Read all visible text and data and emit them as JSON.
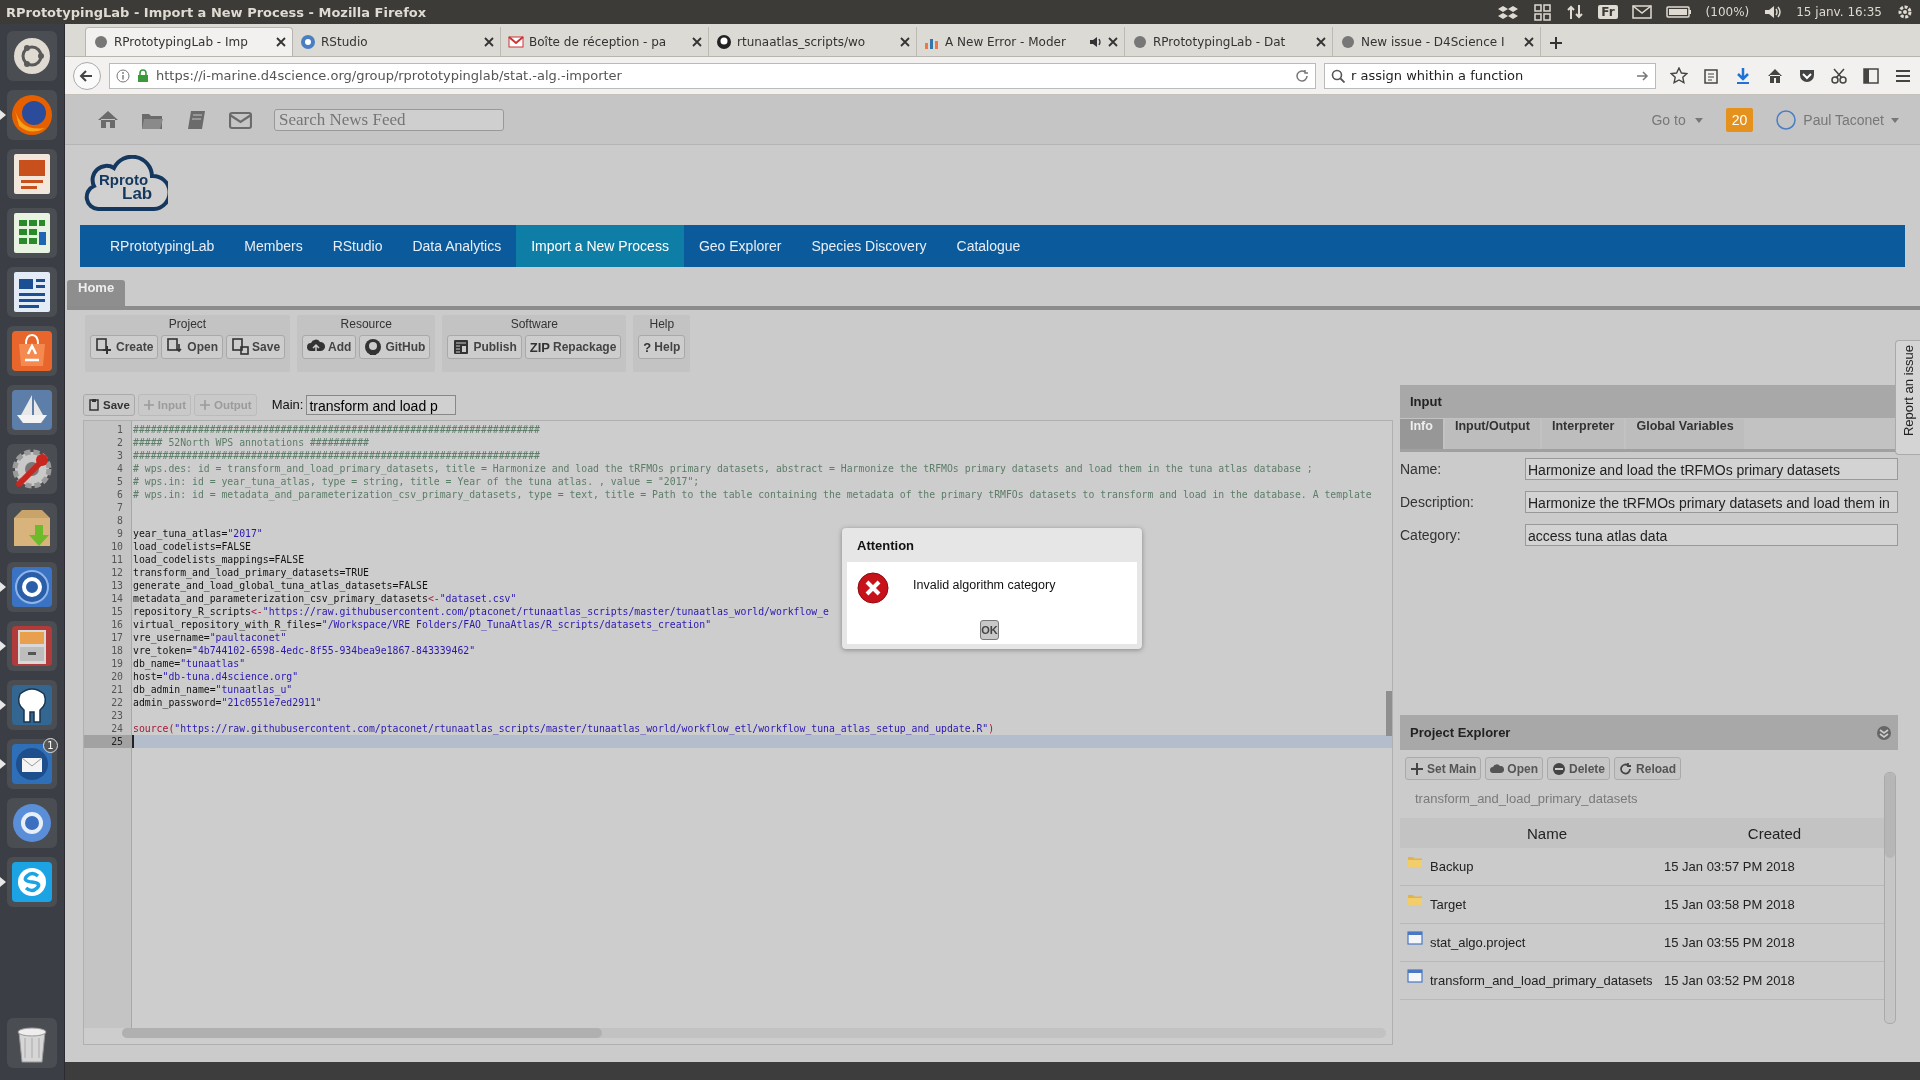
{
  "system_bar": {
    "title": "RPrototypingLab - Import a New Process - Mozilla Firefox",
    "keyboard": "Fr",
    "battery": "(100%)",
    "clock": "15 janv. 16:35"
  },
  "launcher": [
    {
      "kind": "dash",
      "running": false
    },
    {
      "kind": "firefox",
      "running": true
    },
    {
      "kind": "impress",
      "running": false
    },
    {
      "kind": "calc",
      "running": false
    },
    {
      "kind": "writer",
      "running": false
    },
    {
      "kind": "store",
      "running": false
    },
    {
      "kind": "boat",
      "running": false
    },
    {
      "kind": "tools",
      "running": false
    },
    {
      "kind": "package",
      "running": false
    },
    {
      "kind": "r",
      "running": true
    },
    {
      "kind": "cabinet",
      "running": true
    },
    {
      "kind": "elephant",
      "running": true
    },
    {
      "kind": "mail",
      "running": true,
      "badge": "1"
    },
    {
      "kind": "chromium",
      "running": false
    },
    {
      "kind": "skype",
      "running": true
    },
    {
      "kind": "trash",
      "running": false
    }
  ],
  "browser_tabs": [
    {
      "kind": "page",
      "title": "RPrototypingLab - Imp",
      "selected": true,
      "audio": false
    },
    {
      "kind": "rstudio",
      "title": "RStudio",
      "selected": false,
      "audio": false
    },
    {
      "kind": "mail",
      "title": "Boîte de réception - pa",
      "selected": false,
      "audio": false
    },
    {
      "kind": "github",
      "title": "rtunaatlas_scripts/wo",
      "selected": false,
      "audio": false
    },
    {
      "kind": "chart",
      "title": "A New Error - Moder",
      "selected": false,
      "audio": true
    },
    {
      "kind": "page",
      "title": "RPrototypingLab - Dat",
      "selected": false,
      "audio": false
    },
    {
      "kind": "page",
      "title": "New issue - D4Science I",
      "selected": false,
      "audio": false
    }
  ],
  "address_bar": {
    "url": "https://i-marine.d4science.org/group/rprototypinglab/stat.-alg.-importer"
  },
  "search_bar": {
    "value": "r assign whithin a function"
  },
  "portal_header": {
    "search": {
      "placeholder": "Search News Feed"
    },
    "goto": "Go to",
    "notifications": "20",
    "user": "Paul Taconet"
  },
  "logo": {
    "line_1": "Rproto",
    "line_2": "Lab"
  },
  "nav": [
    {
      "label": "RPrototypingLab",
      "selected": false
    },
    {
      "label": "Members",
      "selected": false
    },
    {
      "label": "RStudio",
      "selected": false
    },
    {
      "label": "Data Analytics",
      "selected": false
    },
    {
      "label": "Import a New Process",
      "selected": true
    },
    {
      "label": "Geo Explorer",
      "selected": false
    },
    {
      "label": "Species Discovery",
      "selected": false
    },
    {
      "label": "Catalogue",
      "selected": false
    }
  ],
  "page_tabs": [
    {
      "label": "Home",
      "selected": true
    }
  ],
  "ribbon": [
    {
      "title": "Project",
      "buttons": [
        {
          "kind": "create",
          "label": "Create"
        },
        {
          "kind": "open",
          "label": "Open"
        },
        {
          "kind": "save",
          "label": "Save"
        }
      ]
    },
    {
      "title": "Resource",
      "buttons": [
        {
          "kind": "add",
          "label": "Add"
        },
        {
          "kind": "github",
          "label": "GitHub"
        }
      ]
    },
    {
      "title": "Software",
      "buttons": [
        {
          "kind": "publish",
          "label": "Publish"
        },
        {
          "kind": "repackage",
          "label": "Repackage",
          "icon_text": "ZIP"
        }
      ]
    },
    {
      "title": "Help",
      "buttons": [
        {
          "kind": "help",
          "label": "Help",
          "icon_text": "?"
        }
      ]
    }
  ],
  "editor": {
    "toolbar": [
      {
        "kind": "save",
        "label": "Save",
        "disabled": false
      },
      {
        "kind": "add",
        "label": "Input",
        "disabled": true
      },
      {
        "kind": "add",
        "label": "Output",
        "disabled": true
      }
    ],
    "main_label": "Main:",
    "main_value": "transform and load p",
    "lines": [
      {
        "number": "1",
        "current": false,
        "tokens": [
          {
            "kind": "comment",
            "text": "#####################################################################"
          }
        ]
      },
      {
        "number": "2",
        "current": false,
        "tokens": [
          {
            "kind": "comment",
            "text": "##### 52North WPS annotations ##########"
          }
        ]
      },
      {
        "number": "3",
        "current": false,
        "tokens": [
          {
            "kind": "comment",
            "text": "#####################################################################"
          }
        ]
      },
      {
        "number": "4",
        "current": false,
        "tokens": [
          {
            "kind": "comment",
            "text": "# wps.des: id = transform_and_load_primary_datasets, title = Harmonize and load the tRFMOs primary datasets, abstract = Harmonize the tRFMOs primary datasets and load them in the tuna atlas database ;"
          }
        ]
      },
      {
        "number": "5",
        "current": false,
        "tokens": [
          {
            "kind": "comment",
            "text": "# wps.in: id = year_tuna_atlas, type = string, title = Year of the tuna atlas. , value = \"2017\";"
          }
        ]
      },
      {
        "number": "6",
        "current": false,
        "tokens": [
          {
            "kind": "comment",
            "text": "# wps.in: id = metadata_and_parameterization_csv_primary_datasets, type = text, title = Path to the table containing the metadata of the primary tRMFOs datasets to transform and load in the database. A template"
          }
        ]
      },
      {
        "number": "7",
        "current": false
      },
      {
        "number": "8",
        "current": false
      },
      {
        "number": "9",
        "current": false,
        "tokens": [
          {
            "kind": "plain",
            "text": "year_tuna_atlas="
          },
          {
            "kind": "string",
            "text": "\"2017\""
          }
        ]
      },
      {
        "number": "10",
        "current": false,
        "tokens": [
          {
            "kind": "plain",
            "text": "load_codelists=FALSE"
          }
        ]
      },
      {
        "number": "11",
        "current": false,
        "tokens": [
          {
            "kind": "plain",
            "text": "load_codelists_mappings=FALSE"
          }
        ]
      },
      {
        "number": "12",
        "current": false,
        "tokens": [
          {
            "kind": "plain",
            "text": "transform_and_load_primary_datasets=TRUE"
          }
        ]
      },
      {
        "number": "13",
        "current": false,
        "tokens": [
          {
            "kind": "plain",
            "text": "generate_and_load_global_tuna_atlas_datasets=FALSE"
          }
        ]
      },
      {
        "number": "14",
        "current": false,
        "tokens": [
          {
            "kind": "plain",
            "text": "metadata_and_parameterization_csv_primary_datasets"
          },
          {
            "kind": "operator",
            "text": "<-"
          },
          {
            "kind": "string",
            "text": "\"dataset.csv\""
          }
        ]
      },
      {
        "number": "15",
        "current": false,
        "tokens": [
          {
            "kind": "plain",
            "text": "repository_R_scripts"
          },
          {
            "kind": "operator",
            "text": "<-"
          },
          {
            "kind": "string",
            "text": "\"https://raw.githubusercontent.com/ptaconet/rtunaatlas_scripts/master/tunaatlas_world/workflow_e"
          }
        ]
      },
      {
        "number": "16",
        "current": false,
        "tokens": [
          {
            "kind": "plain",
            "text": "virtual_repository_with_R_files="
          },
          {
            "kind": "string",
            "text": "\"/Workspace/VRE Folders/FAO_TunaAtlas/R_scripts/datasets_creation\""
          }
        ]
      },
      {
        "number": "17",
        "current": false,
        "tokens": [
          {
            "kind": "plain",
            "text": "vre_username="
          },
          {
            "kind": "string",
            "text": "\"paultaconet\""
          }
        ]
      },
      {
        "number": "18",
        "current": false,
        "tokens": [
          {
            "kind": "plain",
            "text": "vre_token="
          },
          {
            "kind": "string",
            "text": "\"4b744102-6598-4edc-8f55-934bea9e1867-843339462\""
          }
        ]
      },
      {
        "number": "19",
        "current": false,
        "tokens": [
          {
            "kind": "plain",
            "text": "db_name="
          },
          {
            "kind": "string",
            "text": "\"tunaatlas\""
          }
        ]
      },
      {
        "number": "20",
        "current": false,
        "tokens": [
          {
            "kind": "plain",
            "text": "host="
          },
          {
            "kind": "string",
            "text": "\"db-tuna.d4science.org\""
          }
        ]
      },
      {
        "number": "21",
        "current": false,
        "tokens": [
          {
            "kind": "plain",
            "text": "db_admin_name="
          },
          {
            "kind": "string",
            "text": "\"tunaatlas_u\""
          }
        ]
      },
      {
        "number": "22",
        "current": false,
        "tokens": [
          {
            "kind": "plain",
            "text": "admin_password="
          },
          {
            "kind": "string",
            "text": "\"21c0551e7ed2911\""
          }
        ]
      },
      {
        "number": "23",
        "current": false
      },
      {
        "number": "24",
        "current": false,
        "tokens": [
          {
            "kind": "operator",
            "text": "source("
          },
          {
            "kind": "string",
            "text": "\"https://raw.githubusercontent.com/ptaconet/rtunaatlas_scripts/master/tunaatlas_world/workflow_etl/workflow_tuna_atlas_setup_and_update.R\""
          },
          {
            "kind": "operator",
            "text": ")"
          }
        ]
      },
      {
        "number": "25",
        "current": true
      }
    ]
  },
  "input_panel": {
    "title": "Input",
    "tabs": [
      {
        "label": "Info",
        "selected": true
      },
      {
        "label": "Input/Output",
        "selected": false
      },
      {
        "label": "Interpreter",
        "selected": false
      },
      {
        "label": "Global Variables",
        "selected": false
      }
    ],
    "fields": [
      {
        "label": "Name:",
        "value": "Harmonize and load the tRFMOs primary datasets"
      },
      {
        "label": "Description:",
        "value": "Harmonize the tRFMOs primary datasets and load them in"
      },
      {
        "label": "Category:",
        "value": "access tuna atlas data"
      }
    ]
  },
  "project_explorer": {
    "title": "Project Explorer",
    "buttons": [
      {
        "kind": "add",
        "label": "Set Main"
      },
      {
        "kind": "cloud",
        "label": "Open"
      },
      {
        "kind": "minus",
        "label": "Delete"
      },
      {
        "kind": "reload",
        "label": "Reload"
      }
    ],
    "main_file": "transform_and_load_primary_datasets",
    "columns": [
      "Name",
      "Created"
    ],
    "rows": [
      {
        "kind": "folder",
        "name": "Backup",
        "created": "15 Jan 03:57 PM 2018"
      },
      {
        "kind": "folder",
        "name": "Target",
        "created": "15 Jan 03:58 PM 2018"
      },
      {
        "kind": "file",
        "name": "stat_algo.project",
        "created": "15 Jan 03:55 PM 2018"
      },
      {
        "kind": "file",
        "name": "transform_and_load_primary_datasets",
        "created": "15 Jan 03:52 PM 2018"
      }
    ]
  },
  "dialog": {
    "title": "Attention",
    "message": "Invalid algorithm category",
    "button": "OK"
  },
  "report_tab": {
    "label": "Report an issue"
  }
}
